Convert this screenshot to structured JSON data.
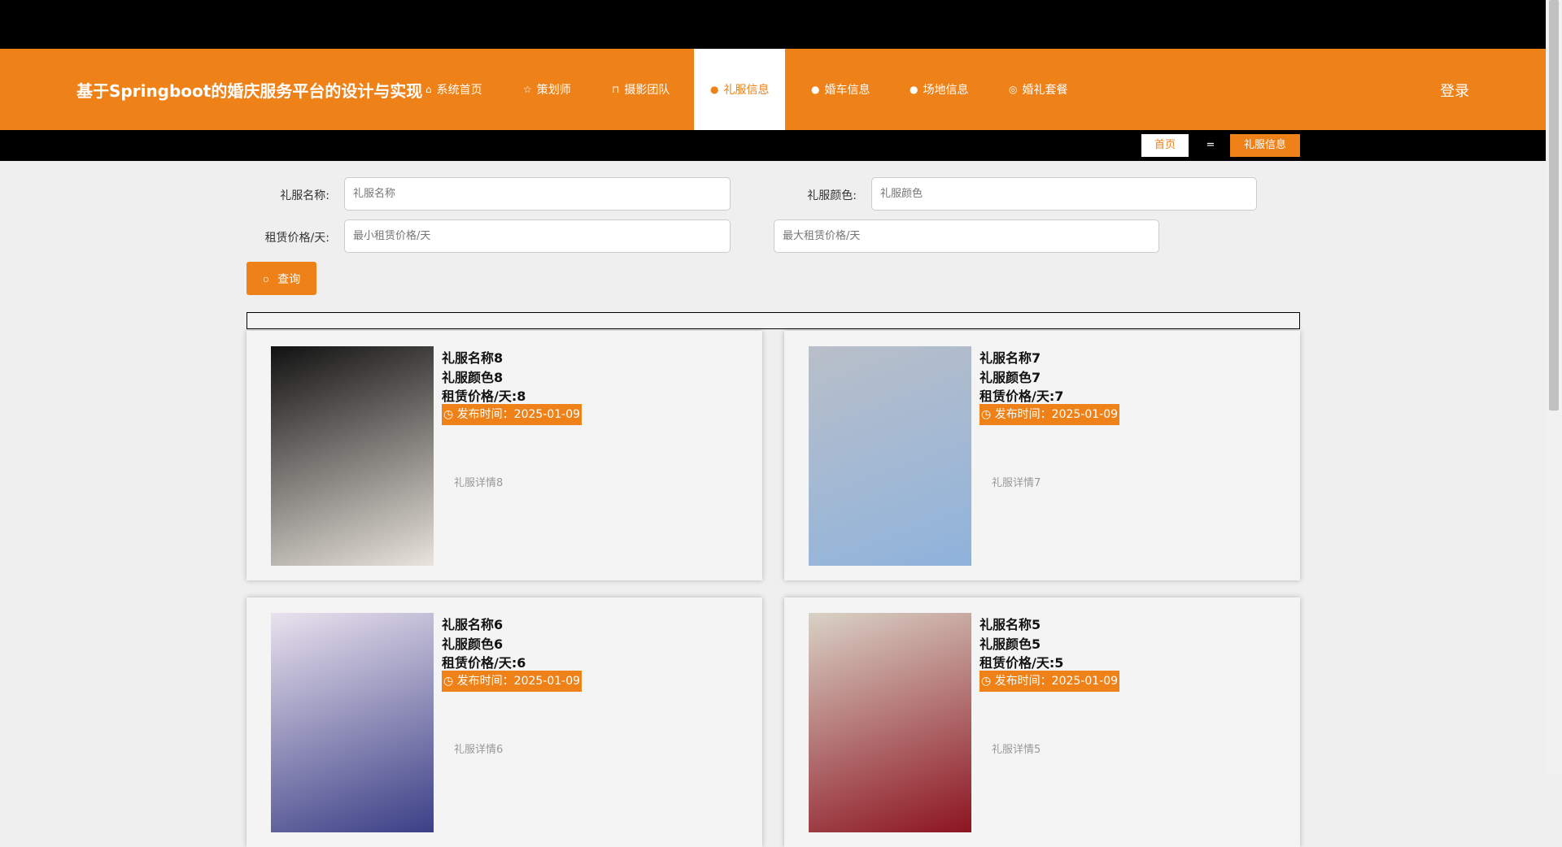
{
  "header": {
    "title": "基于Springboot的婚庆服务平台的设计与实现",
    "login": "登录",
    "nav": [
      {
        "label": "系统首页",
        "icon": "⌂"
      },
      {
        "label": "策划师",
        "icon": "☆"
      },
      {
        "label": "摄影团队",
        "icon": "⊓"
      },
      {
        "label": "礼服信息",
        "icon": "●"
      },
      {
        "label": "婚车信息",
        "icon": "●"
      },
      {
        "label": "场地信息",
        "icon": "●"
      },
      {
        "label": "婚礼套餐",
        "icon": "◎"
      }
    ]
  },
  "breadcrumb": {
    "home": "首页",
    "sep": "=",
    "current": "礼服信息"
  },
  "search": {
    "name_label": "礼服名称:",
    "name_placeholder": "礼服名称",
    "color_label": "礼服颜色:",
    "color_placeholder": "礼服颜色",
    "price_label": "租赁价格/天:",
    "min_placeholder": "最小租赁价格/天",
    "max_placeholder": "最大租赁价格/天",
    "button": "查询"
  },
  "cards": [
    {
      "name": "礼服名称8",
      "color": "礼服颜色8",
      "price": "租赁价格/天:8",
      "date": "发布时间：2025-01-09",
      "detail": "礼服详情8",
      "c1": "#111",
      "c2": "#e9e4dc"
    },
    {
      "name": "礼服名称7",
      "color": "礼服颜色7",
      "price": "租赁价格/天:7",
      "date": "发布时间：2025-01-09",
      "detail": "礼服详情7",
      "c1": "#b9bfc9",
      "c2": "#8fb3dc"
    },
    {
      "name": "礼服名称6",
      "color": "礼服颜色6",
      "price": "租赁价格/天:6",
      "date": "发布时间：2025-01-09",
      "detail": "礼服详情6",
      "c1": "#e9e2ee",
      "c2": "#3b3f86"
    },
    {
      "name": "礼服名称5",
      "color": "礼服颜色5",
      "price": "租赁价格/天:5",
      "date": "发布时间：2025-01-09",
      "detail": "礼服详情5",
      "c1": "#d9d2c6",
      "c2": "#8c1420"
    }
  ]
}
